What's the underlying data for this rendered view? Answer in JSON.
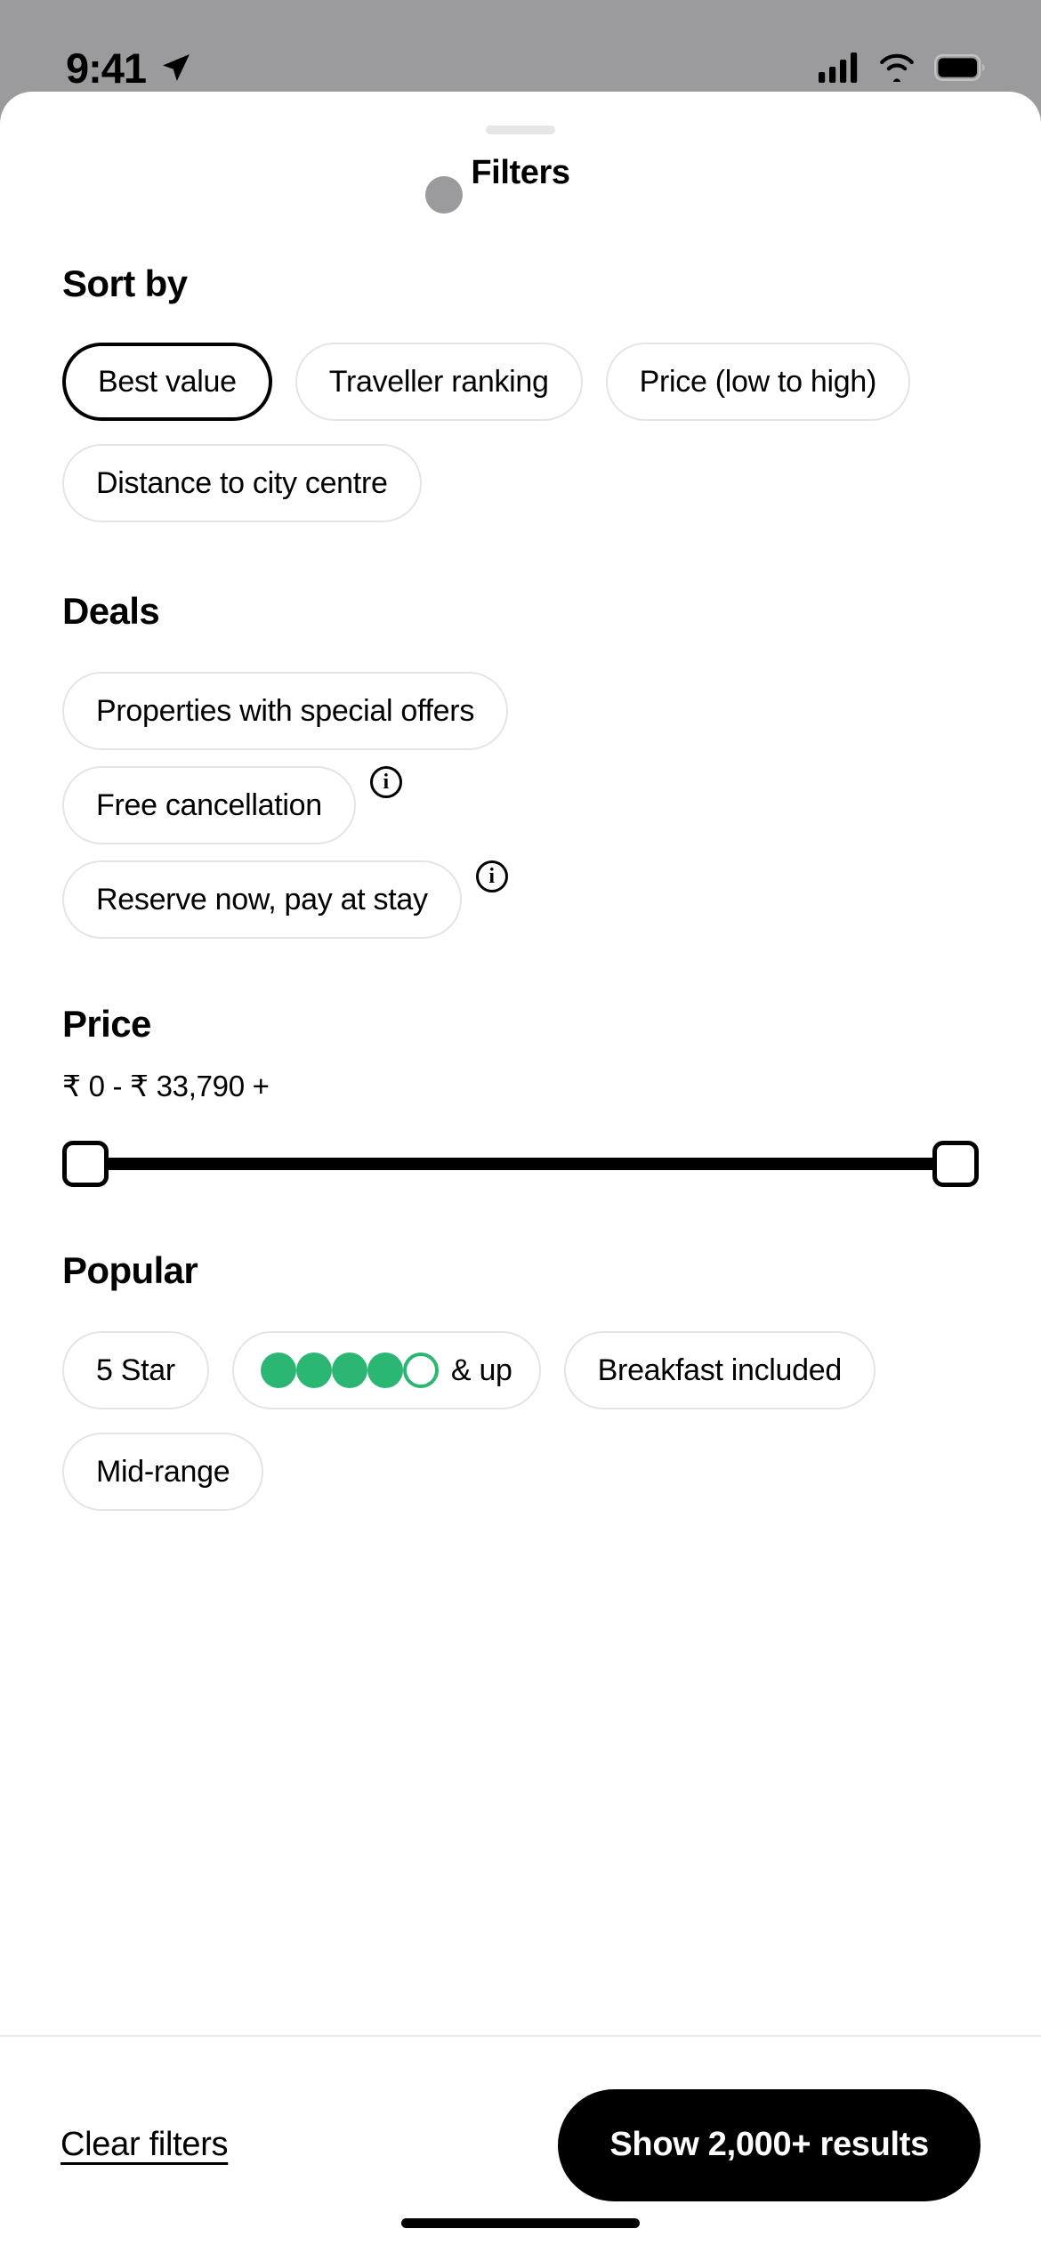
{
  "status_bar": {
    "time": "9:41",
    "icons": [
      "location-arrow-icon",
      "cellular-signal-icon",
      "wifi-icon",
      "battery-icon"
    ]
  },
  "sheet": {
    "title": "Filters",
    "handle": "grab-handle"
  },
  "sections": {
    "sort_by": {
      "title": "Sort by",
      "options": [
        {
          "label": "Best value",
          "selected": true
        },
        {
          "label": "Traveller ranking",
          "selected": false
        },
        {
          "label": "Price (low to high)",
          "selected": false
        },
        {
          "label": "Distance to city centre",
          "selected": false
        }
      ]
    },
    "deals": {
      "title": "Deals",
      "options": [
        {
          "label": "Properties with special offers",
          "selected": false,
          "info": false
        },
        {
          "label": "Free cancellation",
          "selected": false,
          "info": true
        },
        {
          "label": "Reserve now, pay at stay",
          "selected": false,
          "info": true
        }
      ],
      "info_glyph": "i"
    },
    "price": {
      "title": "Price",
      "range_label": "₹ 0 - ₹ 33,790 +",
      "min_handle": "slider-handle-min",
      "max_handle": "slider-handle-max"
    },
    "popular": {
      "title": "Popular",
      "options": [
        {
          "label": "5 Star",
          "type": "text",
          "selected": false
        },
        {
          "label": "& up",
          "type": "rating",
          "filled": 4,
          "total": 5,
          "selected": false
        },
        {
          "label": "Breakfast included",
          "type": "text",
          "selected": false
        },
        {
          "label": "Mid-range",
          "type": "text",
          "selected": false
        }
      ]
    }
  },
  "footer": {
    "clear_label": "Clear filters",
    "show_label": "Show 2,000+ results"
  },
  "colors": {
    "rating_green": "#2bb673",
    "accent_black": "#000000",
    "chip_border": "#e4e4e6",
    "status_bg": "#9b9b9d"
  }
}
